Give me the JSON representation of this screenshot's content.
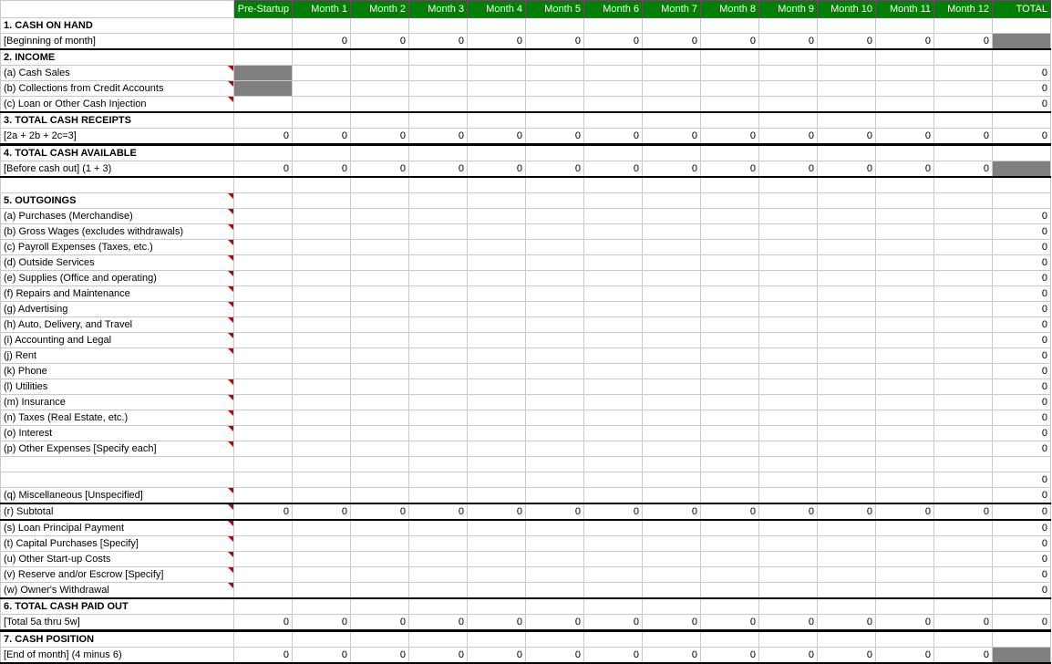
{
  "headers": [
    "Pre-Startup",
    "Month 1",
    "Month 2",
    "Month 3",
    "Month 4",
    "Month 5",
    "Month 6",
    "Month 7",
    "Month 8",
    "Month 9",
    "Month 10",
    "Month 11",
    "Month 12",
    "TOTAL"
  ],
  "rows": [
    {
      "label": "1. CASH ON HAND",
      "bold": true,
      "marker": false,
      "topBorder": false,
      "values": [
        null,
        null,
        null,
        null,
        null,
        null,
        null,
        null,
        null,
        null,
        null,
        null,
        null,
        null
      ],
      "totalGrey": false
    },
    {
      "label": "[Beginning of month]",
      "bold": false,
      "indent": true,
      "marker": false,
      "values": [
        null,
        "0",
        "0",
        "0",
        "0",
        "0",
        "0",
        "0",
        "0",
        "0",
        "0",
        "0",
        "0",
        null
      ],
      "totalGrey": true,
      "bottomBorder": true
    },
    {
      "label": "2. INCOME",
      "bold": true,
      "marker": false,
      "values": [
        null,
        null,
        null,
        null,
        null,
        null,
        null,
        null,
        null,
        null,
        null,
        null,
        null,
        null
      ]
    },
    {
      "label": "(a) Cash Sales",
      "indent": true,
      "marker": true,
      "preGrey": true,
      "values": [
        null,
        null,
        null,
        null,
        null,
        null,
        null,
        null,
        null,
        null,
        null,
        null,
        null,
        "0"
      ]
    },
    {
      "label": "(b) Collections from Credit Accounts",
      "indent": true,
      "marker": true,
      "preGrey": true,
      "values": [
        null,
        null,
        null,
        null,
        null,
        null,
        null,
        null,
        null,
        null,
        null,
        null,
        null,
        "0"
      ]
    },
    {
      "label": "(c) Loan or Other Cash Injection",
      "indent": true,
      "marker": true,
      "values": [
        null,
        null,
        null,
        null,
        null,
        null,
        null,
        null,
        null,
        null,
        null,
        null,
        null,
        "0"
      ],
      "bottomBorder": true
    },
    {
      "label": "3. TOTAL CASH RECEIPTS",
      "bold": true,
      "values": [
        null,
        null,
        null,
        null,
        null,
        null,
        null,
        null,
        null,
        null,
        null,
        null,
        null,
        null
      ]
    },
    {
      "label": "[2a + 2b + 2c=3]",
      "indent": true,
      "values": [
        "0",
        "0",
        "0",
        "0",
        "0",
        "0",
        "0",
        "0",
        "0",
        "0",
        "0",
        "0",
        "0",
        "0"
      ],
      "thickerBottom": true
    },
    {
      "label": "4. TOTAL CASH AVAILABLE",
      "bold": true,
      "values": [
        null,
        null,
        null,
        null,
        null,
        null,
        null,
        null,
        null,
        null,
        null,
        null,
        null,
        null
      ]
    },
    {
      "label": "[Before cash out] (1 + 3)",
      "indent": true,
      "values": [
        "0",
        "0",
        "0",
        "0",
        "0",
        "0",
        "0",
        "0",
        "0",
        "0",
        "0",
        "0",
        "0",
        null
      ],
      "totalGrey": true,
      "bottomBorder": true
    },
    {
      "label": "",
      "blank": true,
      "values": [
        null,
        null,
        null,
        null,
        null,
        null,
        null,
        null,
        null,
        null,
        null,
        null,
        null,
        null
      ]
    },
    {
      "label": "5. OUTGOINGS",
      "bold": true,
      "marker": true,
      "values": [
        null,
        null,
        null,
        null,
        null,
        null,
        null,
        null,
        null,
        null,
        null,
        null,
        null,
        null
      ]
    },
    {
      "label": "(a) Purchases (Merchandise)",
      "indent": true,
      "marker": true,
      "values": [
        null,
        null,
        null,
        null,
        null,
        null,
        null,
        null,
        null,
        null,
        null,
        null,
        null,
        "0"
      ]
    },
    {
      "label": "(b) Gross Wages (excludes withdrawals)",
      "indent": true,
      "marker": true,
      "values": [
        null,
        null,
        null,
        null,
        null,
        null,
        null,
        null,
        null,
        null,
        null,
        null,
        null,
        "0"
      ]
    },
    {
      "label": "(c) Payroll Expenses (Taxes, etc.)",
      "indent": true,
      "marker": true,
      "values": [
        null,
        null,
        null,
        null,
        null,
        null,
        null,
        null,
        null,
        null,
        null,
        null,
        null,
        "0"
      ]
    },
    {
      "label": "(d) Outside Services",
      "indent": true,
      "marker": true,
      "values": [
        null,
        null,
        null,
        null,
        null,
        null,
        null,
        null,
        null,
        null,
        null,
        null,
        null,
        "0"
      ]
    },
    {
      "label": "(e) Supplies (Office and operating)",
      "indent": true,
      "marker": true,
      "values": [
        null,
        null,
        null,
        null,
        null,
        null,
        null,
        null,
        null,
        null,
        null,
        null,
        null,
        "0"
      ]
    },
    {
      "label": "(f) Repairs and Maintenance",
      "indent": true,
      "marker": true,
      "values": [
        null,
        null,
        null,
        null,
        null,
        null,
        null,
        null,
        null,
        null,
        null,
        null,
        null,
        "0"
      ]
    },
    {
      "label": "(g) Advertising",
      "indent": true,
      "marker": true,
      "values": [
        null,
        null,
        null,
        null,
        null,
        null,
        null,
        null,
        null,
        null,
        null,
        null,
        null,
        "0"
      ]
    },
    {
      "label": "(h) Auto, Delivery, and Travel",
      "indent": true,
      "marker": true,
      "values": [
        null,
        null,
        null,
        null,
        null,
        null,
        null,
        null,
        null,
        null,
        null,
        null,
        null,
        "0"
      ]
    },
    {
      "label": "(i) Accounting and Legal",
      "indent": true,
      "marker": true,
      "values": [
        null,
        null,
        null,
        null,
        null,
        null,
        null,
        null,
        null,
        null,
        null,
        null,
        null,
        "0"
      ]
    },
    {
      "label": "(j) Rent",
      "indent": true,
      "marker": true,
      "values": [
        null,
        null,
        null,
        null,
        null,
        null,
        null,
        null,
        null,
        null,
        null,
        null,
        null,
        "0"
      ]
    },
    {
      "label": "(k) Phone",
      "indent": true,
      "values": [
        null,
        null,
        null,
        null,
        null,
        null,
        null,
        null,
        null,
        null,
        null,
        null,
        null,
        "0"
      ]
    },
    {
      "label": "(l) Utilities",
      "indent": true,
      "marker": true,
      "values": [
        null,
        null,
        null,
        null,
        null,
        null,
        null,
        null,
        null,
        null,
        null,
        null,
        null,
        "0"
      ]
    },
    {
      "label": "(m) Insurance",
      "indent": true,
      "marker": true,
      "values": [
        null,
        null,
        null,
        null,
        null,
        null,
        null,
        null,
        null,
        null,
        null,
        null,
        null,
        "0"
      ]
    },
    {
      "label": "(n) Taxes (Real Estate, etc.)",
      "indent": true,
      "marker": true,
      "values": [
        null,
        null,
        null,
        null,
        null,
        null,
        null,
        null,
        null,
        null,
        null,
        null,
        null,
        "0"
      ]
    },
    {
      "label": "(o) Interest",
      "indent": true,
      "marker": true,
      "values": [
        null,
        null,
        null,
        null,
        null,
        null,
        null,
        null,
        null,
        null,
        null,
        null,
        null,
        "0"
      ]
    },
    {
      "label": "(p) Other Expenses [Specify each]",
      "indent": true,
      "marker": true,
      "values": [
        null,
        null,
        null,
        null,
        null,
        null,
        null,
        null,
        null,
        null,
        null,
        null,
        null,
        "0"
      ]
    },
    {
      "label": "",
      "indent": true,
      "values": [
        null,
        null,
        null,
        null,
        null,
        null,
        null,
        null,
        null,
        null,
        null,
        null,
        null,
        null
      ]
    },
    {
      "label": "",
      "indent": true,
      "values": [
        null,
        null,
        null,
        null,
        null,
        null,
        null,
        null,
        null,
        null,
        null,
        null,
        null,
        "0"
      ]
    },
    {
      "label": "(q) Miscellaneous [Unspecified]",
      "indent": true,
      "marker": true,
      "values": [
        null,
        null,
        null,
        null,
        null,
        null,
        null,
        null,
        null,
        null,
        null,
        null,
        null,
        "0"
      ],
      "bottomBorder": true
    },
    {
      "label": "(r) Subtotal",
      "indent": true,
      "marker": true,
      "values": [
        "0",
        "0",
        "0",
        "0",
        "0",
        "0",
        "0",
        "0",
        "0",
        "0",
        "0",
        "0",
        "0",
        "0"
      ],
      "bottomBorder": true
    },
    {
      "label": "(s) Loan Principal Payment",
      "indent": true,
      "marker": true,
      "values": [
        null,
        null,
        null,
        null,
        null,
        null,
        null,
        null,
        null,
        null,
        null,
        null,
        null,
        "0"
      ]
    },
    {
      "label": "(t) Capital Purchases [Specify]",
      "indent": true,
      "marker": true,
      "values": [
        null,
        null,
        null,
        null,
        null,
        null,
        null,
        null,
        null,
        null,
        null,
        null,
        null,
        "0"
      ]
    },
    {
      "label": "(u) Other Start-up Costs",
      "indent": true,
      "marker": true,
      "values": [
        null,
        null,
        null,
        null,
        null,
        null,
        null,
        null,
        null,
        null,
        null,
        null,
        null,
        "0"
      ]
    },
    {
      "label": "(v) Reserve and/or Escrow [Specify]",
      "indent": true,
      "marker": true,
      "values": [
        null,
        null,
        null,
        null,
        null,
        null,
        null,
        null,
        null,
        null,
        null,
        null,
        null,
        "0"
      ]
    },
    {
      "label": "(w) Owner's Withdrawal",
      "indent": true,
      "marker": true,
      "values": [
        null,
        null,
        null,
        null,
        null,
        null,
        null,
        null,
        null,
        null,
        null,
        null,
        null,
        "0"
      ],
      "bottomBorder": true
    },
    {
      "label": "6. TOTAL CASH PAID OUT",
      "bold": true,
      "values": [
        null,
        null,
        null,
        null,
        null,
        null,
        null,
        null,
        null,
        null,
        null,
        null,
        null,
        null
      ]
    },
    {
      "label": "[Total 5a thru 5w]",
      "indent": true,
      "values": [
        "0",
        "0",
        "0",
        "0",
        "0",
        "0",
        "0",
        "0",
        "0",
        "0",
        "0",
        "0",
        "0",
        "0"
      ],
      "thickerBottom": true
    },
    {
      "label": "7. CASH POSITION",
      "bold": true,
      "values": [
        null,
        null,
        null,
        null,
        null,
        null,
        null,
        null,
        null,
        null,
        null,
        null,
        null,
        null
      ]
    },
    {
      "label": "[End of month]  (4 minus 6)",
      "indent": true,
      "values": [
        "0",
        "0",
        "0",
        "0",
        "0",
        "0",
        "0",
        "0",
        "0",
        "0",
        "0",
        "0",
        "0",
        null
      ],
      "totalGrey": true,
      "bottomBorder": true
    }
  ]
}
